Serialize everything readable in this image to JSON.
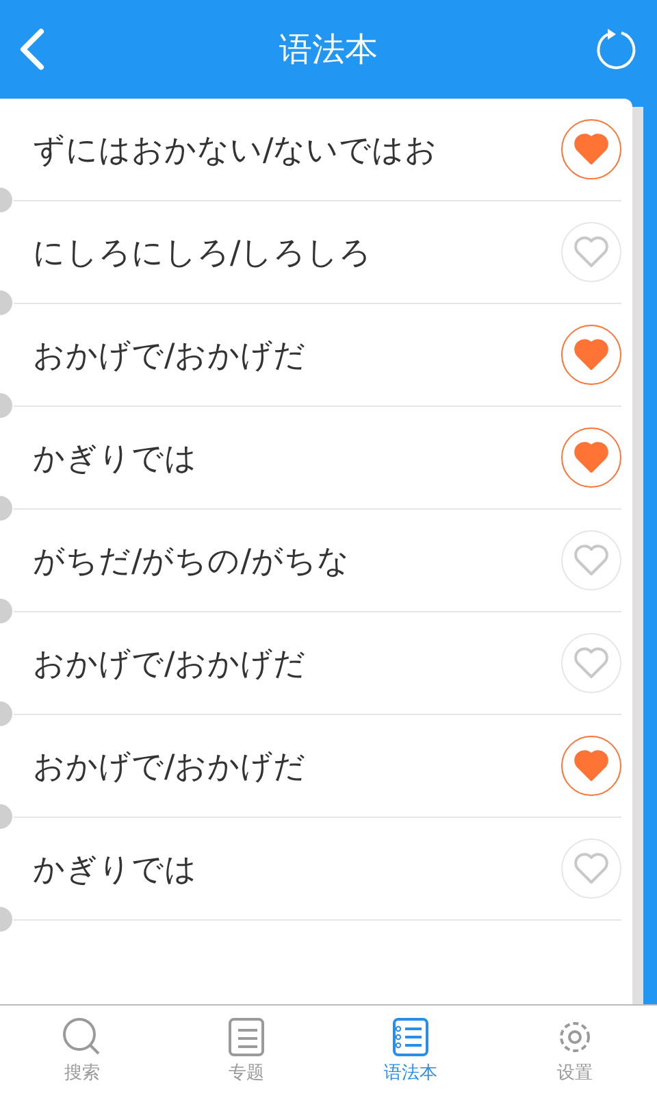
{
  "header": {
    "title": "语法本"
  },
  "entries": [
    {
      "text": "ずにはおかない/ないではお",
      "favorite": true
    },
    {
      "text": "にしろにしろ/しろしろ",
      "favorite": false
    },
    {
      "text": "おかげで/おかげだ",
      "favorite": true
    },
    {
      "text": "かぎりでは",
      "favorite": true
    },
    {
      "text": "がちだ/がちの/がちな",
      "favorite": false
    },
    {
      "text": "おかげで/おかげだ",
      "favorite": false
    },
    {
      "text": "おかげで/おかげだ",
      "favorite": true
    },
    {
      "text": "かぎりでは",
      "favorite": false
    }
  ],
  "tabs": [
    {
      "kind": "search",
      "label": "搜索",
      "selected": false
    },
    {
      "kind": "topics",
      "label": "专题",
      "selected": false
    },
    {
      "kind": "notebook",
      "label": "语法本",
      "selected": true
    },
    {
      "kind": "settings",
      "label": "设置",
      "selected": false
    }
  ]
}
